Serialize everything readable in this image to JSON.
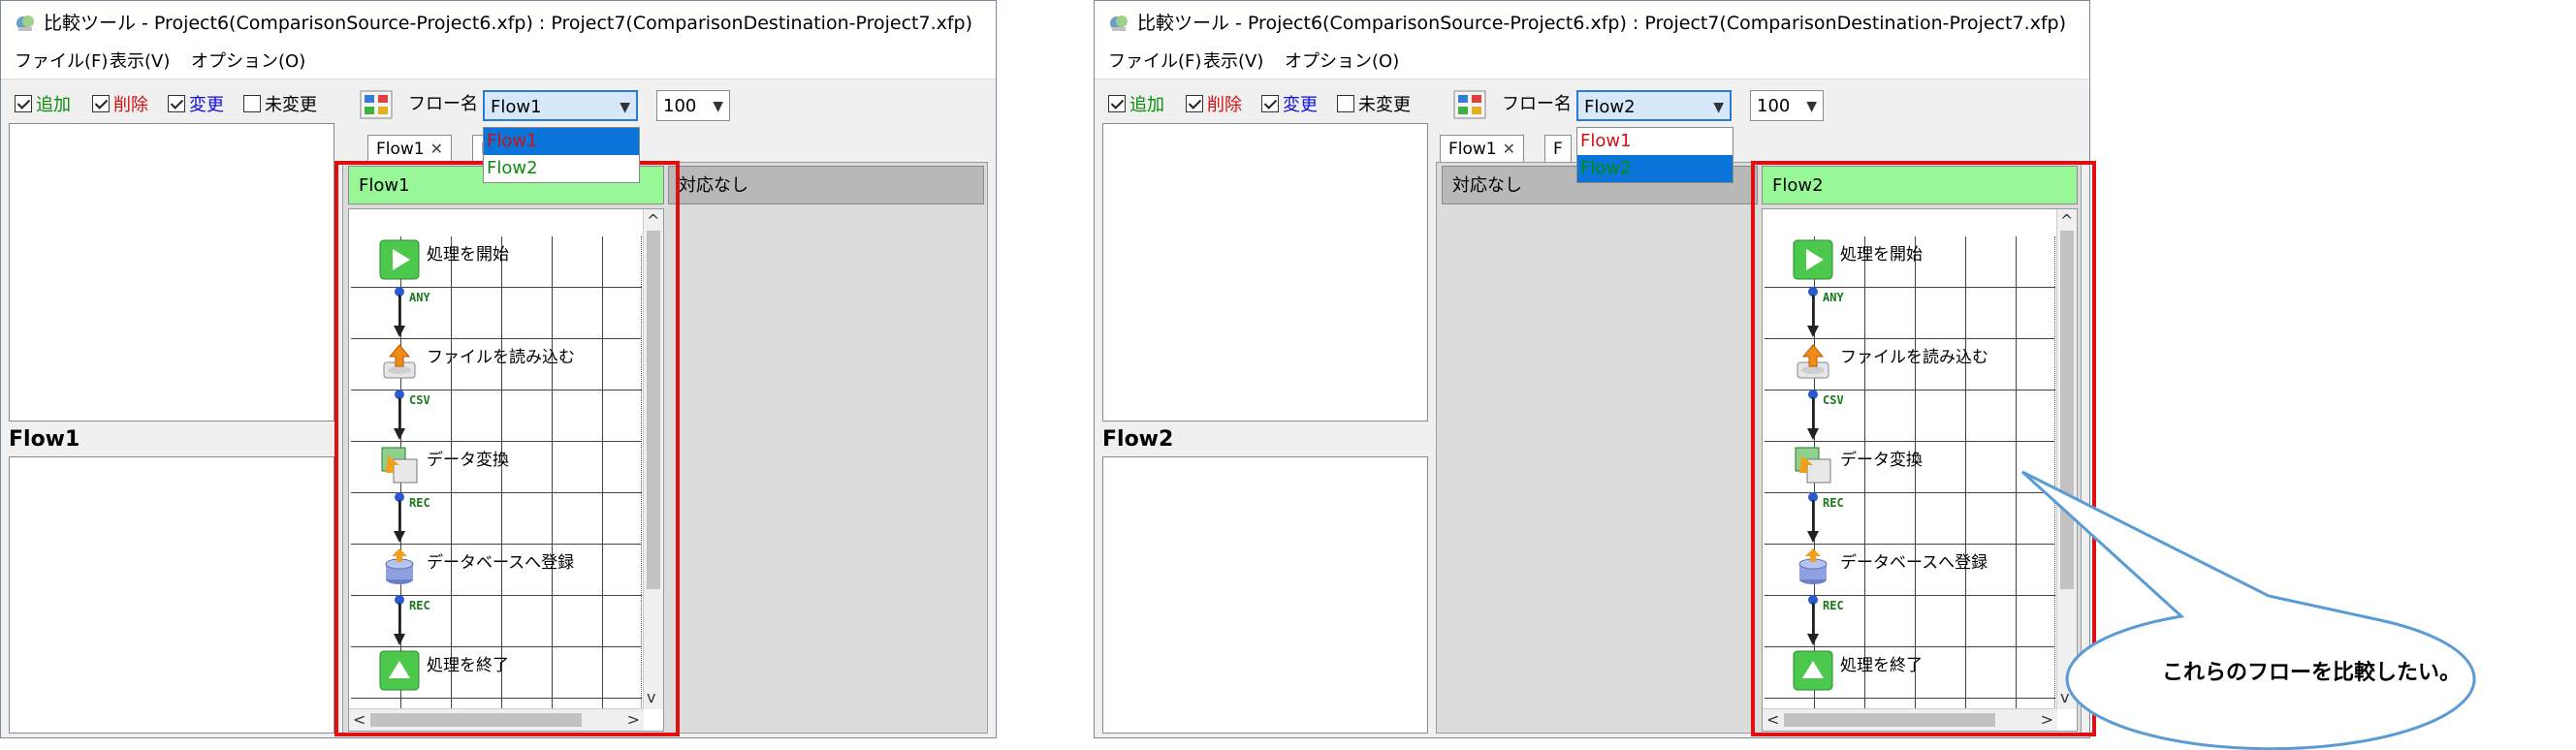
{
  "windows": [
    {
      "title": "比較ツール - Project6(ComparisonSource-Project6.xfp) : Project7(ComparisonDestination-Project7.xfp)",
      "menu": [
        "ファイル(F)",
        "表示(V)",
        "オプション(O)"
      ],
      "filters": [
        {
          "label": "追加",
          "checked": true,
          "color": "#0a8a0a"
        },
        {
          "label": "削除",
          "checked": true,
          "color": "#d01010"
        },
        {
          "label": "変更",
          "checked": true,
          "color": "#1010e0"
        },
        {
          "label": "未変更",
          "checked": false,
          "color": "#000000"
        }
      ],
      "flow_name_label": "フロー名",
      "selected_flow": "Flow1",
      "zoom": "100",
      "dropdown_options": [
        "Flow1",
        "Flow2"
      ],
      "left_label": "Flow1",
      "tabs": [
        "Flow1",
        "F"
      ],
      "green_header": "Flow1",
      "gray_header": "対応なし"
    },
    {
      "title": "比較ツール - Project6(ComparisonSource-Project6.xfp) : Project7(ComparisonDestination-Project7.xfp)",
      "menu": [
        "ファイル(F)",
        "表示(V)",
        "オプション(O)"
      ],
      "filters": [
        {
          "label": "追加",
          "checked": true,
          "color": "#0a8a0a"
        },
        {
          "label": "削除",
          "checked": true,
          "color": "#d01010"
        },
        {
          "label": "変更",
          "checked": true,
          "color": "#1010e0"
        },
        {
          "label": "未変更",
          "checked": false,
          "color": "#000000"
        }
      ],
      "flow_name_label": "フロー名",
      "selected_flow": "Flow2",
      "zoom": "100",
      "dropdown_options": [
        "Flow1",
        "Flow2"
      ],
      "left_label": "Flow2",
      "tabs": [
        "Flow1",
        "F"
      ],
      "green_header": "Flow2",
      "gray_header": "対応なし"
    }
  ],
  "flow_nodes": [
    {
      "label": "処理を開始",
      "icon": "start-icon"
    },
    {
      "label": "ファイルを読み込む",
      "icon": "file-read-icon"
    },
    {
      "label": "データ変換",
      "icon": "data-convert-icon"
    },
    {
      "label": "データベースへ登録",
      "icon": "database-register-icon"
    },
    {
      "label": "処理を終了",
      "icon": "end-icon"
    }
  ],
  "flow_edges": [
    "ANY",
    "CSV",
    "REC",
    "REC"
  ],
  "callout": {
    "text": "これらのフローを比較したい。",
    "color": "#5b9bd5"
  },
  "highlight_color": "#e01010"
}
